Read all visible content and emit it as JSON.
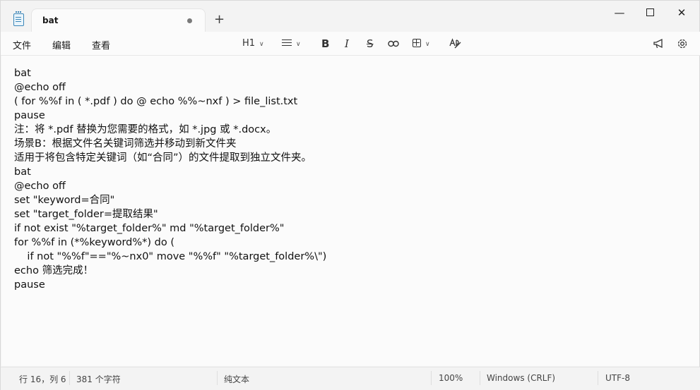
{
  "tab": {
    "title": "bat"
  },
  "window": {
    "new_tab": "+",
    "minimize": "—",
    "close": "✕"
  },
  "menu": {
    "file": "文件",
    "edit": "编辑",
    "view": "查看"
  },
  "toolbar": {
    "heading": "H1",
    "bold": "B",
    "italic": "I",
    "strike": "S"
  },
  "editor": {
    "lines": [
      "bat",
      "@echo off",
      "( for %%f in ( *.pdf ) do @ echo %%~nxf ) > file_list.txt",
      "pause",
      "注：将 *.pdf 替换为您需要的格式，如 *.jpg 或 *.docx。",
      "场景B：根据文件名关键词筛选并移动到新文件夹",
      "适用于将包含特定关键词（如“合同”）的文件提取到独立文件夹。",
      "bat",
      "@echo off",
      "set \"keyword=合同\"",
      "set \"target_folder=提取结果\"",
      "if not exist \"%target_folder%\" md \"%target_folder%\"",
      "for %%f in (*%keyword%*) do (",
      "    if not \"%%f\"==\"%~nx0\" move \"%%f\" \"%target_folder%\\\")",
      "echo 筛选完成！",
      "pause"
    ]
  },
  "status": {
    "position": "行 16，列 6",
    "chars": "381 个字符",
    "format": "纯文本",
    "zoom": "100%",
    "line_ending": "Windows (CRLF)",
    "encoding": "UTF-8"
  }
}
